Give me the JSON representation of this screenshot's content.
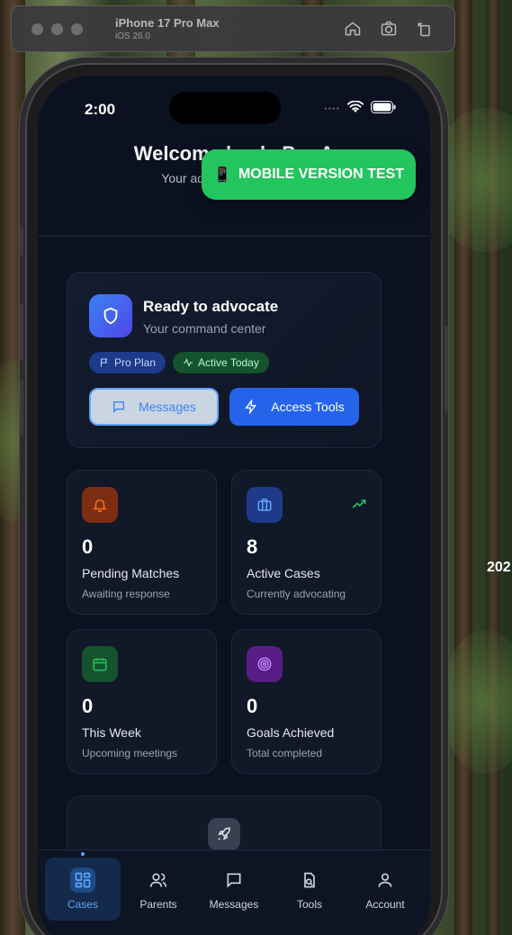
{
  "simulator": {
    "device_name": "iPhone 17 Pro Max",
    "os_version": "iOS 26.0",
    "icons": [
      "home-icon",
      "screenshot-icon",
      "rotate-icon"
    ]
  },
  "background": {
    "side_text": "202"
  },
  "status_bar": {
    "time": "2:00"
  },
  "header": {
    "title": "Welcome back, Pro A",
    "subtitle": "Your advocacy dashboard"
  },
  "test_banner": {
    "label": "MOBILE VERSION TEST",
    "color": "#22c55e"
  },
  "hero": {
    "title": "Ready to advocate",
    "subtitle": "Your command center",
    "badges": [
      "Pro Plan",
      "Active Today"
    ],
    "messages_label": "Messages",
    "tools_label": "Access Tools"
  },
  "stats": [
    {
      "value": "0",
      "label": "Pending Matches",
      "sub": "Awaiting response",
      "icon": "bell-icon",
      "color": "#f97316"
    },
    {
      "value": "8",
      "label": "Active Cases",
      "sub": "Currently advocating",
      "icon": "briefcase-icon",
      "color": "#60a5fa"
    },
    {
      "value": "0",
      "label": "This Week",
      "sub": "Upcoming meetings",
      "icon": "calendar-icon",
      "color": "#22c55e"
    },
    {
      "value": "0",
      "label": "Goals Achieved",
      "sub": "Total completed",
      "icon": "target-icon",
      "color": "#c084fc"
    }
  ],
  "tabs": [
    {
      "label": "Cases",
      "icon": "grid-icon",
      "active": true
    },
    {
      "label": "Parents",
      "icon": "users-icon",
      "active": false
    },
    {
      "label": "Messages",
      "icon": "chat-icon",
      "active": false
    },
    {
      "label": "Tools",
      "icon": "tools-icon",
      "active": false
    },
    {
      "label": "Account",
      "icon": "user-icon",
      "active": false
    }
  ]
}
